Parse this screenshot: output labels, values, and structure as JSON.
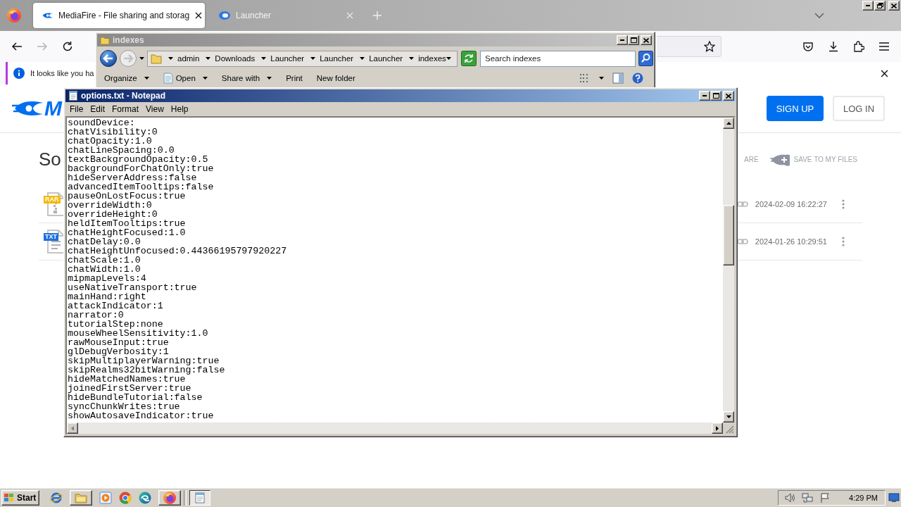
{
  "browser": {
    "tabs": [
      {
        "title": "MediaFire - File sharing and storag",
        "selected": true
      },
      {
        "title": "Launcher",
        "selected": false
      }
    ],
    "notification": {
      "text": "It looks like you ha"
    },
    "page": {
      "logo_text": "M",
      "buttons": [
        {
          "label": "SIGN UP",
          "kind": "primary"
        },
        {
          "label": "LOG IN",
          "kind": "outline"
        }
      ],
      "heading": "So",
      "actions": [
        {
          "label": "ARE",
          "kind": "text"
        },
        {
          "label": "SAVE TO MY FILES",
          "kind": "save"
        }
      ],
      "files": [
        {
          "kind": "archive",
          "badge": "RAR",
          "color": "#f5b800",
          "date": "2024-02-09 16:22:27"
        },
        {
          "kind": "document",
          "badge": "TXT",
          "color": "#1e6fdc",
          "date": "2024-01-26 10:29:51"
        }
      ]
    }
  },
  "explorer": {
    "title": "indexes",
    "breadcrumb": [
      "admin",
      "Downloads",
      "Launcher",
      "Launcher",
      "Launcher",
      "indexes"
    ],
    "search": {
      "placeholder": "Search indexes"
    },
    "toolbar": [
      {
        "label": "Organize",
        "kind": "menu"
      },
      {
        "label": "Open",
        "kind": "icon-menu"
      },
      {
        "label": "Share with",
        "kind": "menu"
      },
      {
        "label": "Print",
        "kind": "button"
      },
      {
        "label": "New folder",
        "kind": "button"
      }
    ]
  },
  "notepad": {
    "title": "options.txt - Notepad",
    "menu": [
      "File",
      "Edit",
      "Format",
      "View",
      "Help"
    ],
    "lines": [
      "soundDevice:",
      "chatVisibility:0",
      "chatOpacity:1.0",
      "chatLineSpacing:0.0",
      "textBackgroundOpacity:0.5",
      "backgroundForChatOnly:true",
      "hideServerAddress:false",
      "advancedItemTooltips:false",
      "pauseOnLostFocus:true",
      "overrideWidth:0",
      "overrideHeight:0",
      "heldItemTooltips:true",
      "chatHeightFocused:1.0",
      "chatDelay:0.0",
      "chatHeightUnfocused:0.44366195797920227",
      "chatScale:1.0",
      "chatWidth:1.0",
      "mipmapLevels:4",
      "useNativeTransport:true",
      "mainHand:right",
      "attackIndicator:1",
      "narrator:0",
      "tutorialStep:none",
      "mouseWheelSensitivity:1.0",
      "rawMouseInput:true",
      "glDebugVerbosity:1",
      "skipMultiplayerWarning:true",
      "skipRealms32bitWarning:false",
      "hideMatchedNames:true",
      "joinedFirstServer:true",
      "hideBundleTutorial:false",
      "syncChunkWrites:true",
      "showAutosaveIndicator:true"
    ]
  },
  "taskbar": {
    "start": "Start",
    "clock": "4:29 PM"
  }
}
